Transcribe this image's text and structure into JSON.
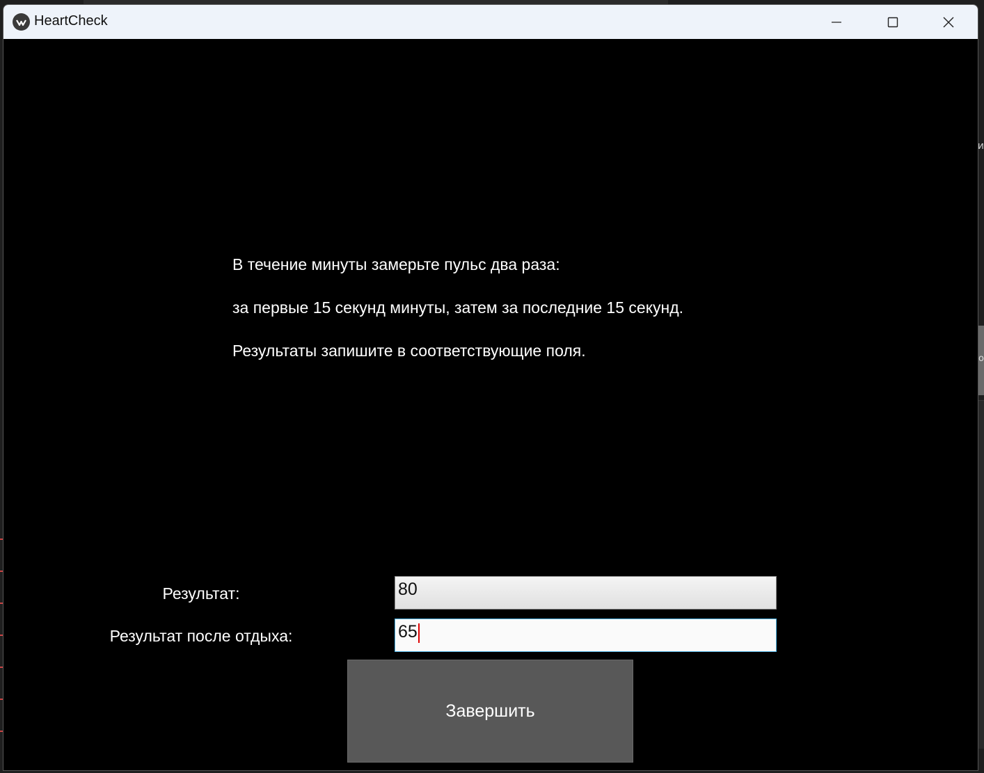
{
  "window": {
    "title": "HeartCheck",
    "controls": {
      "minimize": "minimize-icon",
      "maximize": "maximize-icon",
      "close": "close-icon"
    }
  },
  "instructions": [
    "В течение минуты замерьте пульс два раза:",
    "за первые 15 секунд минуты, затем за последние 15 секунд.",
    "Результаты запишите в соответствующие поля."
  ],
  "form": {
    "result_label": "Результат:",
    "result_value": "80",
    "rest_label": "Результат после отдыха:",
    "rest_value": "65",
    "submit_label": "Завершить"
  },
  "colors": {
    "background": "#000000",
    "titlebar": "#eef3fa",
    "button": "#585858",
    "focus_border": "#4fb4e6",
    "caret": "#dd0000"
  }
}
